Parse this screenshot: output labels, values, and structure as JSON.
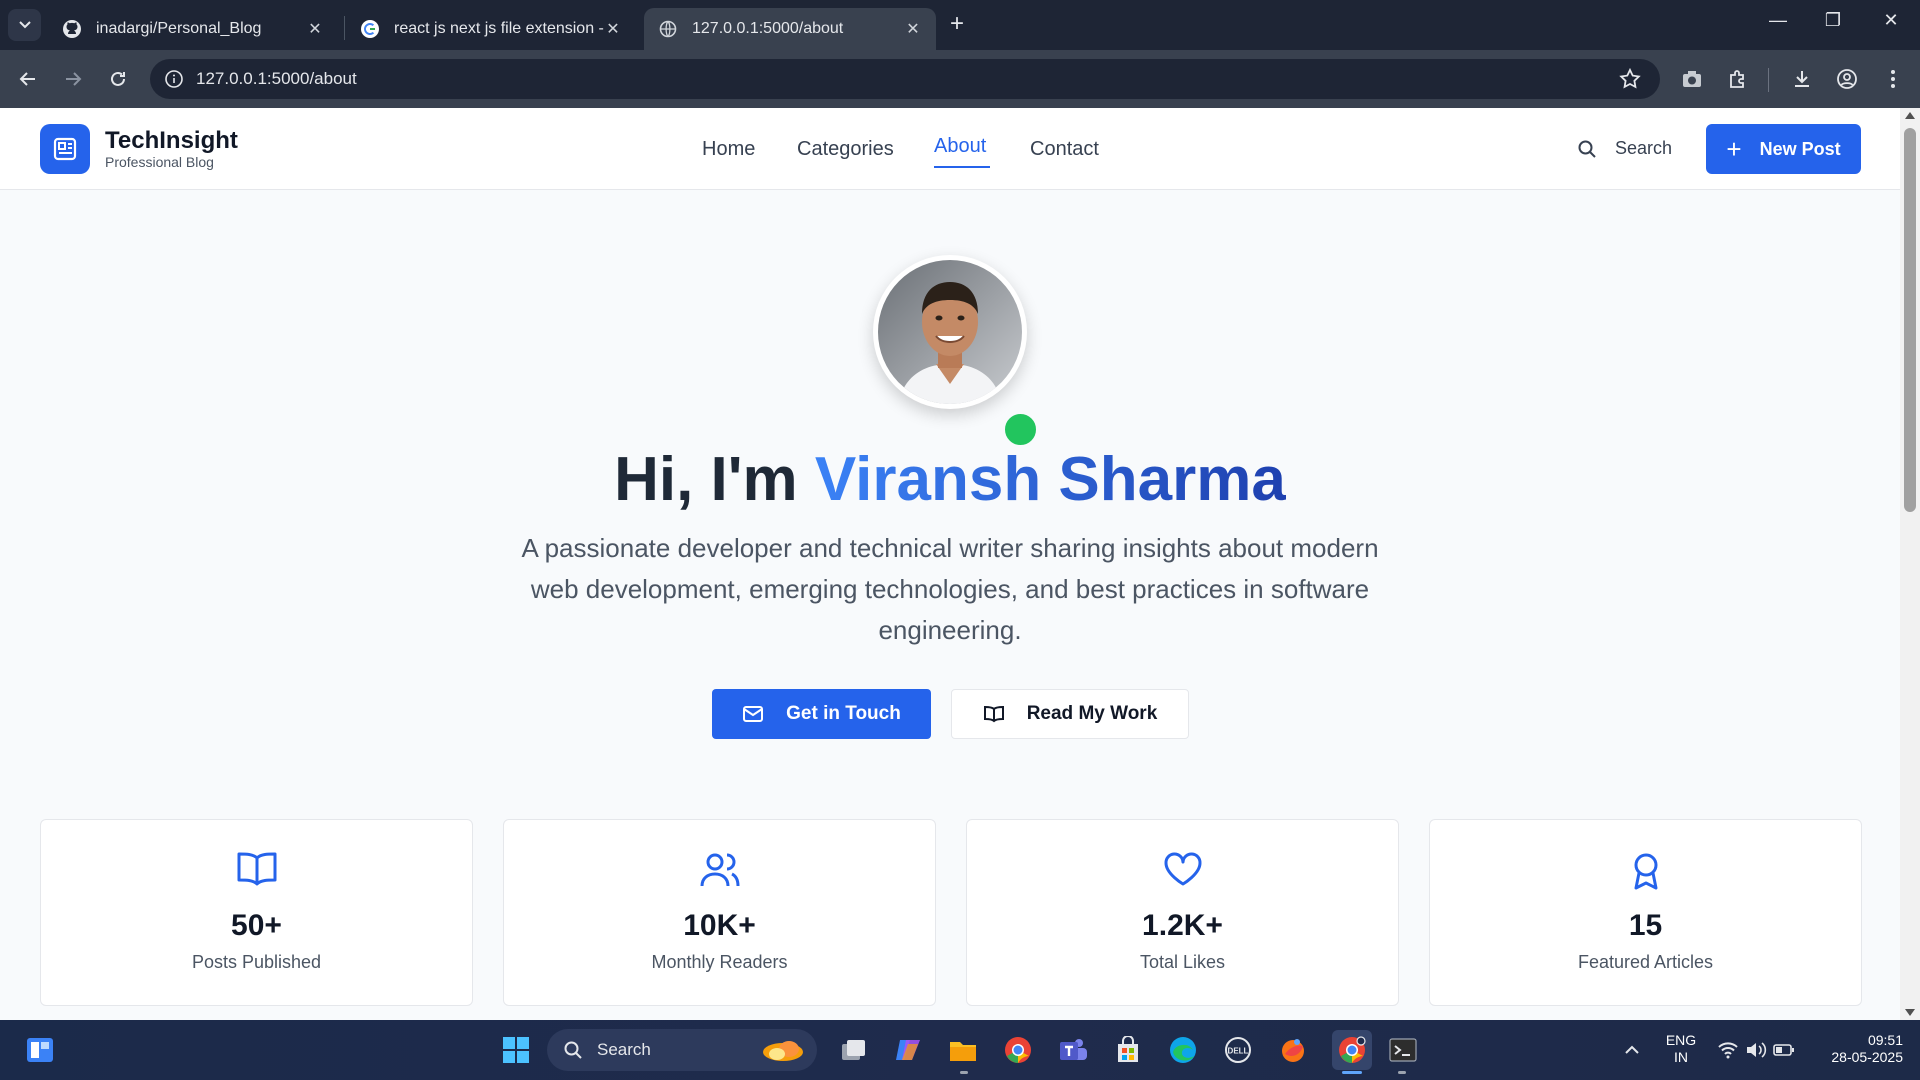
{
  "browser": {
    "tabs": [
      {
        "title": "inadargi/Personal_Blog",
        "icon": "github-icon"
      },
      {
        "title": "react js next js file extension - G",
        "icon": "google-icon"
      },
      {
        "title": "127.0.0.1:5000/about",
        "icon": "globe-icon",
        "active": true
      }
    ],
    "url": "127.0.0.1:5000/about"
  },
  "site": {
    "brand_name": "TechInsight",
    "brand_tagline": "Professional Blog",
    "nav": [
      "Home",
      "Categories",
      "About",
      "Contact"
    ],
    "active_nav": "About",
    "search_label": "Search",
    "new_post_label": "New Post",
    "accent": "#2563eb"
  },
  "hero": {
    "greeting": "Hi, I'm",
    "name": "Viransh Sharma",
    "description": "A passionate developer and technical writer sharing insights about modern web development, emerging technologies, and best practices in software engineering.",
    "primary_button": "Get in Touch",
    "secondary_button": "Read My Work",
    "status_color": "#22c55e"
  },
  "stats": [
    {
      "value": "50+",
      "label": "Posts Published",
      "icon": "book-open-icon"
    },
    {
      "value": "10K+",
      "label": "Monthly Readers",
      "icon": "users-icon"
    },
    {
      "value": "1.2K+",
      "label": "Total Likes",
      "icon": "heart-icon"
    },
    {
      "value": "15",
      "label": "Featured Articles",
      "icon": "award-icon"
    }
  ],
  "taskbar": {
    "search_label": "Search",
    "lang_line1": "ENG",
    "lang_line2": "IN",
    "time": "09:51",
    "date": "28-05-2025"
  }
}
